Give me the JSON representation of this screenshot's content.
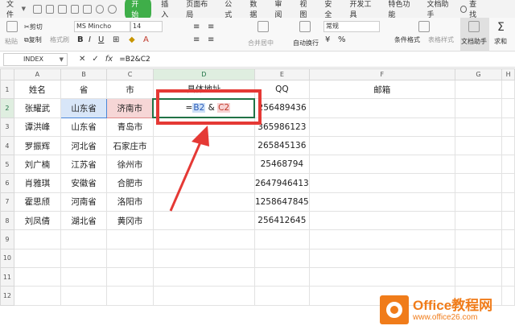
{
  "menubar": {
    "file_label": "文件",
    "tabs": [
      "开始",
      "插入",
      "页面布局",
      "公式",
      "数据",
      "审阅",
      "视图",
      "安全",
      "开发工具",
      "特色功能",
      "文档助手"
    ],
    "active_tab": "开始",
    "search_label": "查找",
    "accent": "#3fae49"
  },
  "toolbar": {
    "cut": "剪切",
    "paste": "粘贴",
    "copy": "复制",
    "format_painter": "格式刷",
    "font_name": "MS Mincho",
    "font_size": "14",
    "merge": "合并居中",
    "wrap": "自动换行",
    "number_format": "常规",
    "conditional_format": "条件格式",
    "table_style": "表格样式",
    "doc_helper": "文档助手",
    "sum": "求和"
  },
  "formula_bar": {
    "name_box": "INDEX",
    "cancel_icon": "✕",
    "confirm_icon": "✓",
    "fx_label": "fx",
    "formula": "=B2&C2"
  },
  "sheet": {
    "columns": [
      "A",
      "B",
      "C",
      "D",
      "E",
      "F",
      "G",
      "H"
    ],
    "rows": [
      "1",
      "2",
      "3",
      "4",
      "5",
      "6",
      "7",
      "8",
      "9",
      "10",
      "11",
      "12"
    ],
    "header": [
      "姓名",
      "省",
      "市",
      "具体地址",
      "QQ",
      "邮箱"
    ],
    "data": [
      [
        "张耀武",
        "山东省",
        "济南市",
        "256489436"
      ],
      [
        "谭洪峰",
        "山东省",
        "青岛市",
        "365986123"
      ],
      [
        "罗振辉",
        "河北省",
        "石家庄市",
        "265845136"
      ],
      [
        "刘广楠",
        "江苏省",
        "徐州市",
        "25468794"
      ],
      [
        "肖雅琪",
        "安徽省",
        "合肥市",
        "2647946413"
      ],
      [
        "霍思颀",
        "河南省",
        "洛阳市",
        "1258647845"
      ],
      [
        "刘凤倩",
        "湖北省",
        "黄冈市",
        "256412645"
      ]
    ],
    "edit_formula": {
      "eq": "=",
      "ref1": "B2",
      "amp": " & ",
      "ref2": "C2"
    }
  },
  "watermark": {
    "title": "Office教程网",
    "url": "www.office26.com"
  },
  "colors": {
    "annotation": "#e53935",
    "ref_blue": "#d8e6f8",
    "ref_red": "#f6d6d6",
    "active_border": "#217346"
  }
}
